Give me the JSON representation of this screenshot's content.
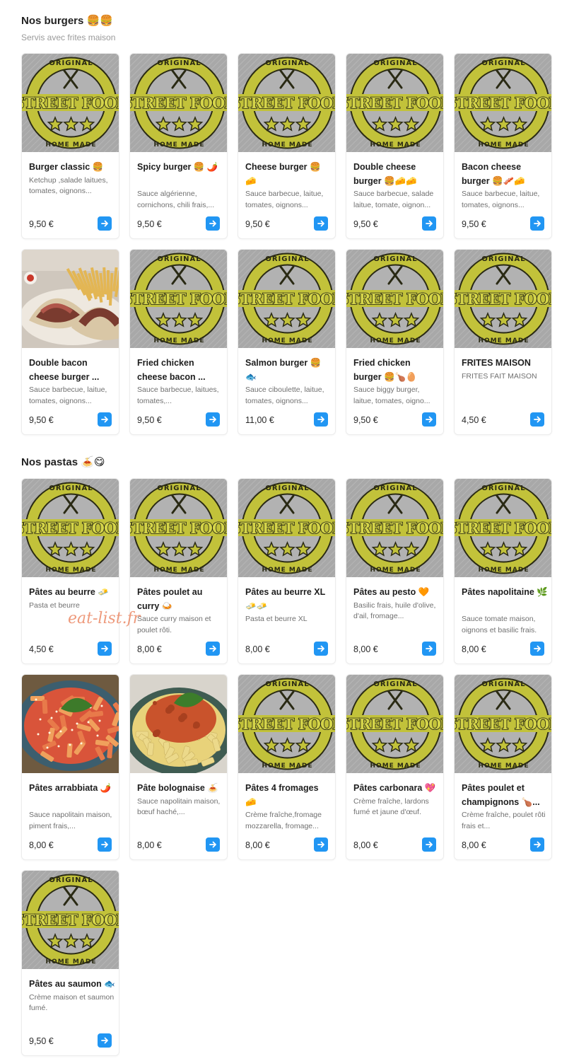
{
  "sections": [
    {
      "title": "Nos burgers 🍔🍔",
      "subtitle": "Servis avec frites maison",
      "items": [
        {
          "name": "Burger classic 🍔",
          "description": "Ketchup ,salade laitues, tomates, oignons...",
          "price": "9,50 €",
          "image": "logo"
        },
        {
          "name": "Spicy burger 🍔 🌶️",
          "description": "Sauce algérienne, cornichons, chili frais,...",
          "price": "9,50 €",
          "image": "logo"
        },
        {
          "name": "Cheese burger 🍔 🧀",
          "description": "Sauce barbecue, laitue, tomates, oignons...",
          "price": "9,50 €",
          "image": "logo"
        },
        {
          "name": "Double cheese burger 🍔🧀🧀",
          "description": "Sauce barbecue, salade laitue, tomate, oignon...",
          "price": "9,50 €",
          "image": "logo"
        },
        {
          "name": "Bacon cheese burger 🍔🥓🧀",
          "description": "Sauce barbecue, laitue, tomates, oignons...",
          "price": "9,50 €",
          "image": "logo"
        },
        {
          "name": "Double bacon cheese burger ...",
          "description": "Sauce barbecue, laitue, tomates, oignons...",
          "price": "9,50 €",
          "image": "photo-wrap"
        },
        {
          "name": "Fried chicken cheese bacon ...",
          "description": "Sauce barbecue, laitues, tomates,...",
          "price": "9,50 €",
          "image": "logo"
        },
        {
          "name": "Salmon burger 🍔 🐟",
          "description": "Sauce ciboulette, laitue, tomates, oignons...",
          "price": "11,00 €",
          "image": "logo"
        },
        {
          "name": "Fried chicken burger 🍔🍗🥚",
          "description": "Sauce biggy burger, laitue, tomates, oigno...",
          "price": "9,50 €",
          "image": "logo"
        },
        {
          "name": "FRITES MAISON",
          "description": "FRITES FAIT MAISON",
          "price": "4,50 €",
          "image": "logo"
        }
      ]
    },
    {
      "title": "Nos pastas 🍝😋",
      "subtitle": "",
      "items": [
        {
          "name": "Pâtes au beurre 🧈",
          "description": "Pasta et beurre",
          "price": "4,50 €",
          "image": "logo"
        },
        {
          "name": "Pâtes poulet au curry 🍛",
          "description": "Sauce curry maison et poulet rôti.",
          "price": "8,00 €",
          "image": "logo"
        },
        {
          "name": "Pâtes au beurre XL 🧈🧈",
          "description": "Pasta et beurre XL",
          "price": "8,00 €",
          "image": "logo"
        },
        {
          "name": "Pâtes au pesto 🧡",
          "description": "Basilic frais, huile d'olive, d'ail, fromage...",
          "price": "8,00 €",
          "image": "logo"
        },
        {
          "name": "Pâtes napolitaine 🌿",
          "description": "Sauce tomate maison, oignons et basilic frais.",
          "price": "8,00 €",
          "image": "logo"
        },
        {
          "name": "Pâtes arrabbiata 🌶️",
          "description": "Sauce napolitain maison, piment frais,...",
          "price": "8,00 €",
          "image": "photo-penne"
        },
        {
          "name": "Pâte bolognaise 🍝",
          "description": "Sauce napolitain maison, bœuf haché,...",
          "price": "8,00 €",
          "image": "photo-bolo"
        },
        {
          "name": "Pâtes 4 fromages 🧀",
          "description": "Crème fraîche,fromage mozzarella, fromage...",
          "price": "8,00 €",
          "image": "logo"
        },
        {
          "name": "Pâtes carbonara 💖",
          "description": "Crème fraîche, lardons fumé et jaune d'œuf.",
          "price": "8,00 €",
          "image": "logo"
        },
        {
          "name": "Pâtes poulet et champignons 🍗...",
          "description": "Crème fraîche, poulet rôti frais et...",
          "price": "8,00 €",
          "image": "logo"
        },
        {
          "name": "Pâtes au saumon 🐟",
          "description": "Crème maison et saumon fumé.",
          "price": "9,50 €",
          "image": "logo"
        }
      ]
    }
  ],
  "logo": {
    "top_text": "ORIGINAL",
    "main_text": "STREET FOOD",
    "bottom_text": "HOME MADE",
    "ring_color": "#c2c23a",
    "bg_color": "#a8a8a8"
  },
  "watermark": "eat-list.fr",
  "accent_color": "#2196f3"
}
